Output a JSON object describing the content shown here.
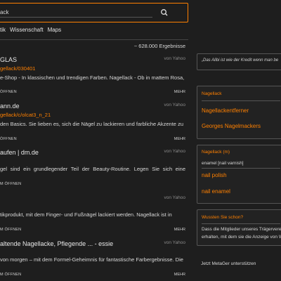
{
  "search": {
    "value": "ack"
  },
  "nav": {
    "items": [
      "tik",
      "Wissenschaft",
      "Maps"
    ]
  },
  "result_count": "~ 628.000 Ergebnisse",
  "results": [
    {
      "title": "GLAS",
      "source": "von Yahoo",
      "link": "gellack/030401",
      "description": "e-Shop - In klassischen und trendigen Farben. Nagellack - Ob in mattem Rosa,",
      "open": "ÖFFNEN",
      "more": "MEHR"
    },
    {
      "title": "ann.de",
      "source": "von Yahoo",
      "link": "gellack/c/olcat3_n_21",
      "description": "den Basics. Sie lieben es, sich die Nägel zu lackieren und farbliche Akzente zu",
      "open": "ÖFFNEN",
      "more": "MEHR"
    },
    {
      "title": "aufen | dm.de",
      "source": "von Yahoo",
      "link": "",
      "description": "gel sind ein grundlegender Teil der Beauty-Routine. Legen Sie sich eine Auswahl",
      "open": "M ÖFFNEN",
      "more": "MEHR"
    },
    {
      "title": "",
      "source": "von Yahoo",
      "link": "",
      "description": "tikprodukt, mit dem Finger- und Fußnägel lackiert werden. Nagellack ist in",
      "open": "M ÖFFNEN",
      "more": "MEHR"
    },
    {
      "title": "altende Nagellacke, Pflegende ... - essie",
      "source": "von Yahoo",
      "link": "",
      "description": "von morgen – mit dem Formel-Geheimnis für fantastische Farbergebnisse. Die",
      "open": "M ÖFFNEN",
      "more": "MEHR"
    }
  ],
  "sidebar": {
    "quote": "„Das Alibi ist wie der Kredit wenn man be",
    "box1": {
      "heading": "Nagellack",
      "links": [
        "Nagellackentferner",
        "Georges Nagelmackers"
      ]
    },
    "box2": {
      "heading": "Nagellack (m)",
      "translation": "enamel [nail varnish]",
      "links": [
        "nail polish",
        "nail enamel"
      ]
    },
    "box3": {
      "heading": "Wussten Sie schon?",
      "lines": [
        "Dass die Mitglieder unseres Trägervere",
        "erhalten, mit dem sie die Anzeige von W"
      ]
    },
    "support": "Jetzt MetaGer unterstützen"
  },
  "colors": {
    "accent": "#ff8000",
    "background": "#1e1e1e"
  },
  "icons": {
    "search": "search-icon"
  }
}
